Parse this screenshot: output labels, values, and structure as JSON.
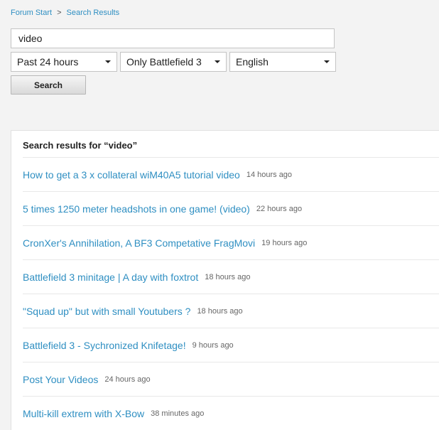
{
  "breadcrumb": {
    "items": [
      "Forum Start",
      "Search Results"
    ],
    "separator": ">"
  },
  "search": {
    "query": "video",
    "button_label": "Search"
  },
  "filters": {
    "time": "Past 24 hours",
    "game": "Only Battlefield 3",
    "language": "English"
  },
  "results": {
    "header_prefix": "Search results for",
    "header_query": "“video”",
    "items": [
      {
        "title": "How to get a 3 x collateral wiM40A5 tutorial video",
        "time": "14 hours ago"
      },
      {
        "title": "5 times 1250 meter headshots in one game! (video)",
        "time": "22 hours ago"
      },
      {
        "title": "CronXer's Annihilation, A BF3 Competative FragMovi",
        "time": "19 hours ago"
      },
      {
        "title": "Battlefield 3 minitage | A day with foxtrot",
        "time": "18 hours ago"
      },
      {
        "title": "\"Squad up\" but with small Youtubers ?",
        "time": "18 hours ago"
      },
      {
        "title": "Battlefield 3 - Sychronized Knifetage!",
        "time": "9 hours ago"
      },
      {
        "title": "Post Your Videos",
        "time": "24 hours ago"
      },
      {
        "title": "Multi-kill extrem with X-Bow",
        "time": "38 minutes ago"
      }
    ]
  },
  "colors": {
    "link": "#2f8fc2",
    "background": "#f3f3f3",
    "panel": "#ffffff"
  }
}
